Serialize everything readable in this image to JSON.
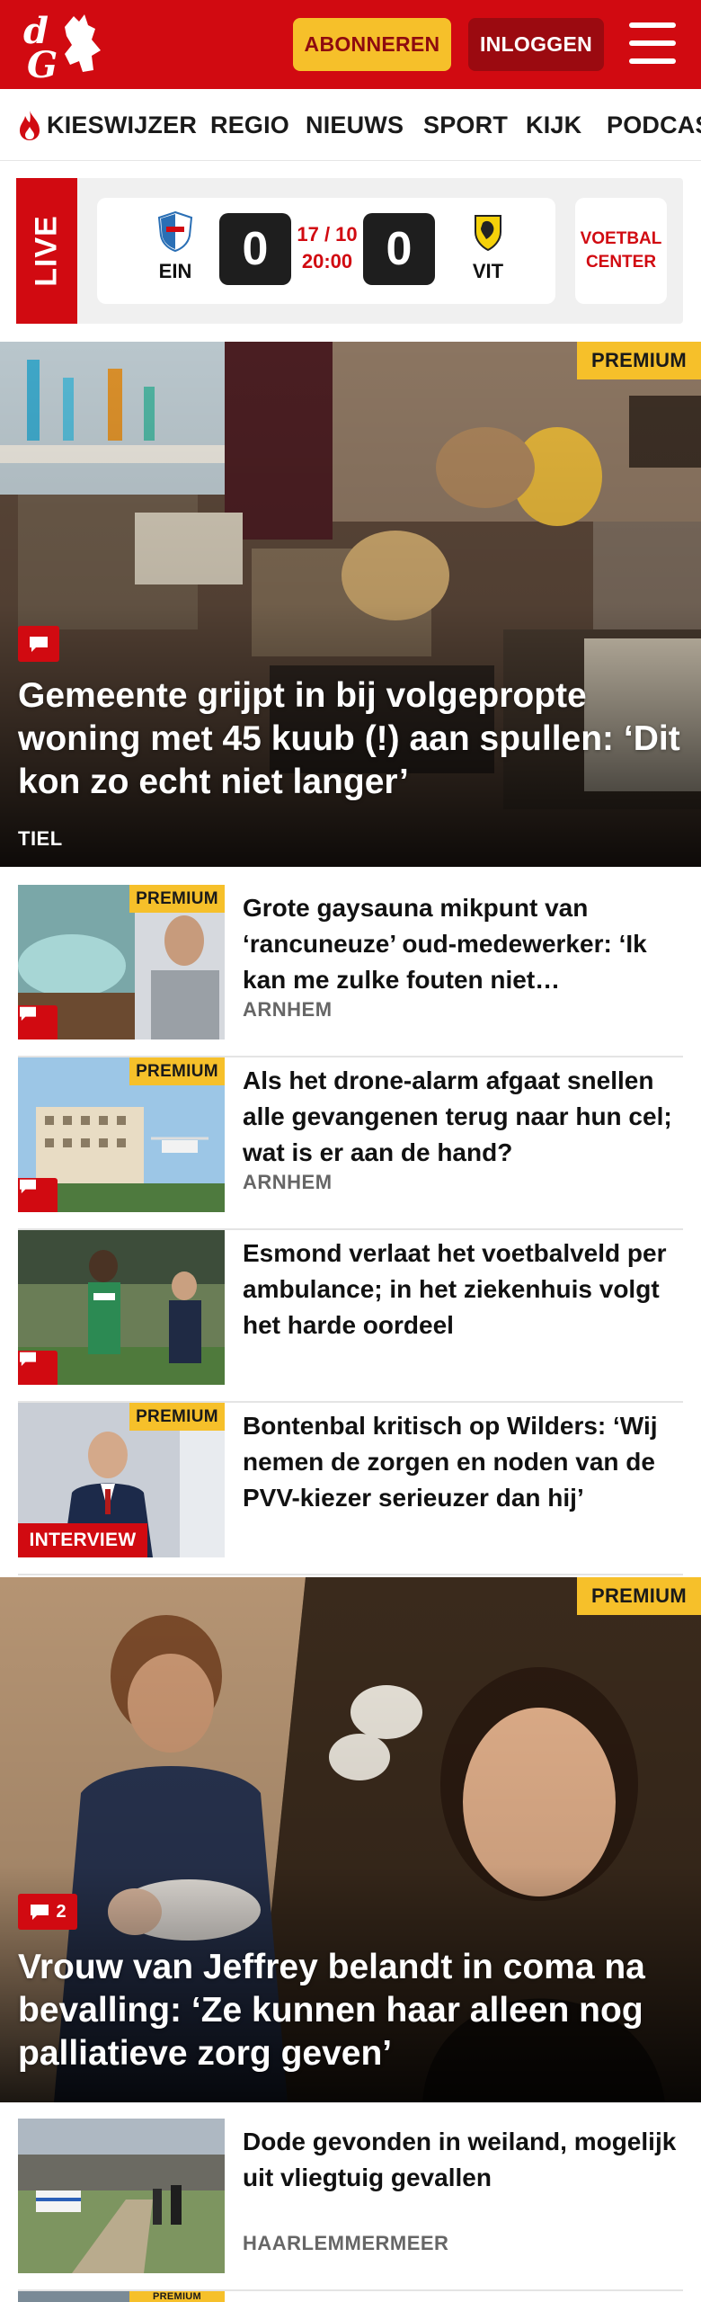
{
  "header": {
    "logo_text": "dG",
    "subscribe_label": "ABONNEREN",
    "login_label": "INLOGGEN",
    "brand_color": "#d10a11",
    "accent_color": "#f6c02a"
  },
  "nav": {
    "items": [
      {
        "label": "KIESWIJZER",
        "icon": "flame-icon"
      },
      {
        "label": "REGIO"
      },
      {
        "label": "NIEUWS"
      },
      {
        "label": "SPORT"
      },
      {
        "label": "KIJK"
      },
      {
        "label": "PODCAS"
      }
    ]
  },
  "live": {
    "label": "LIVE",
    "match": {
      "home_abbr": "EIN",
      "away_abbr": "VIT",
      "home_score": "0",
      "away_score": "0",
      "date": "17 / 10",
      "time": "20:00"
    },
    "center_label_1": "VOETBAL",
    "center_label_2": "CENTER"
  },
  "hero1": {
    "premium": "PREMIUM",
    "title": "Gemeente grijpt in bij volgepropte woning met 45 kuub (!) aan spullen: ‘Dit kon zo echt niet langer’",
    "location": "TIEL"
  },
  "articles": [
    {
      "premium": "PREMIUM",
      "title": "Grote gaysauna mikpunt van ‘rancuneuze’ oud-medewerker: ‘Ik kan me zulke fouten niet veroorloven’",
      "location": "ARNHEM"
    },
    {
      "premium": "PREMIUM",
      "title": "Als het drone-alarm afgaat snellen alle gevangenen terug naar hun cel; wat is er aan de hand?",
      "location": "ARNHEM"
    },
    {
      "title": "Esmond verlaat het voetbalveld per ambulance; in het ziekenhuis volgt het harde oordeel",
      "location": ""
    },
    {
      "premium": "PREMIUM",
      "tag": "INTERVIEW",
      "title": "Bontenbal kritisch op Wilders: ‘Wij nemen de zorgen en noden van de PVV-kiezer serieuzer dan hij’",
      "location": ""
    }
  ],
  "hero2": {
    "premium": "PREMIUM",
    "comment_count": "2",
    "title": "Vrouw van Jeffrey belandt in coma na bevalling: ‘Ze kunnen haar alleen nog palliatieve zorg geven’"
  },
  "article5": {
    "title": "Dode gevonden in weiland, mogelijk uit vliegtuig gevallen",
    "location": "HAARLEMMERMEER"
  },
  "article6": {
    "premium": "PREMIUM"
  }
}
